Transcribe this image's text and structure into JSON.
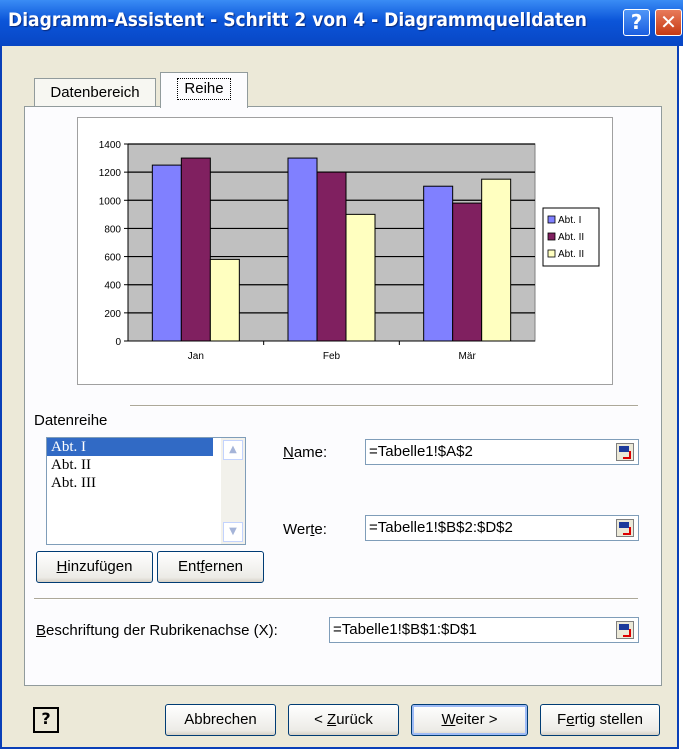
{
  "window": {
    "title": "Diagramm-Assistent - Schritt 2 von 4 - Diagrammquelldaten",
    "help_glyph": "?",
    "close_glyph": "✕"
  },
  "tabs": [
    {
      "label": "Datenbereich"
    },
    {
      "label": "Reihe"
    }
  ],
  "chart_data": {
    "type": "bar",
    "categories": [
      "Jan",
      "Feb",
      "Mär"
    ],
    "series": [
      {
        "name": "Abt. I",
        "values": [
          1250,
          1300,
          1100
        ],
        "color": "#8080ff"
      },
      {
        "name": "Abt. II",
        "values": [
          1300,
          1200,
          980
        ],
        "color": "#802060"
      },
      {
        "name": "Abt. III",
        "values": [
          580,
          900,
          1150
        ],
        "color": "#ffffc0"
      }
    ],
    "legend_labels": [
      "Abt. I",
      "Abt. II",
      "Abt. II"
    ],
    "y_ticks": [
      0,
      200,
      400,
      600,
      800,
      1000,
      1200,
      1400
    ],
    "ylim": [
      0,
      1400
    ],
    "plot_bg": "#c0c0c0",
    "grid": true,
    "legend": "right"
  },
  "series_section": {
    "label": "Datenreihe",
    "items": [
      "Abt. I",
      "Abt. II",
      "Abt. III"
    ],
    "selected_index": 0,
    "add_button": {
      "pre": "",
      "key": "H",
      "post": "inzufügen"
    },
    "remove_button": {
      "pre": "Ent",
      "key": "f",
      "post": "ernen"
    },
    "name_label": {
      "pre": "",
      "key": "N",
      "post": "ame:"
    },
    "name_value": "=Tabelle1!$A$2",
    "values_label": {
      "pre": "Wer",
      "key": "t",
      "post": "e:"
    },
    "values_value": "=Tabelle1!$B$2:$D$2"
  },
  "category_axis": {
    "label": {
      "pre": "",
      "key": "B",
      "post": "eschriftung der Rubrikenachse (X):"
    },
    "value": "=Tabelle1!$B$1:$D$1"
  },
  "footer": {
    "help_glyph": "?",
    "cancel": "Abbrechen",
    "back": {
      "pre": "< ",
      "key": "Z",
      "post": "urück"
    },
    "next": {
      "pre": "",
      "key": "W",
      "post": "eiter >"
    },
    "finish": {
      "pre": "F",
      "key": "e",
      "post": "rtig stellen"
    }
  }
}
